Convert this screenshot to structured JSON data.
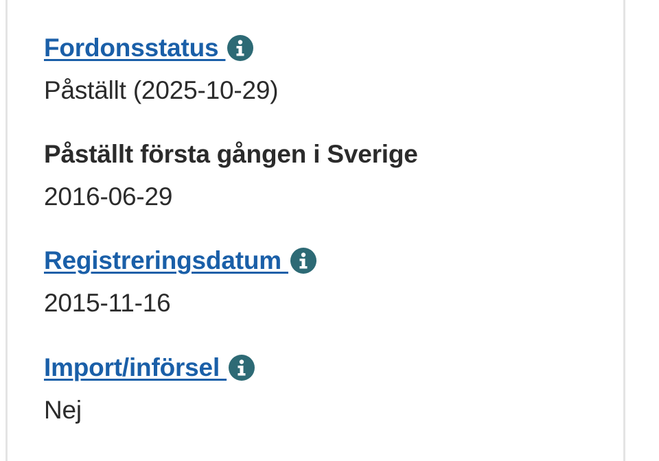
{
  "fields": [
    {
      "label": "Fordonsstatus ",
      "value": "Påställt (2025-10-29)",
      "icon": "info-icon"
    },
    {
      "label": "Påställt första gången i Sverige",
      "value": "2016-06-29"
    },
    {
      "label": "Registreringsdatum ",
      "value": "2015-11-16",
      "icon": "info-icon"
    },
    {
      "label": "Import/införsel ",
      "value": "Nej",
      "icon": "info-icon"
    }
  ],
  "colors": {
    "link": "#1a5fa8",
    "text": "#2b2b2b",
    "icon_bg": "#2d6a75",
    "border": "#e4e4e4"
  }
}
